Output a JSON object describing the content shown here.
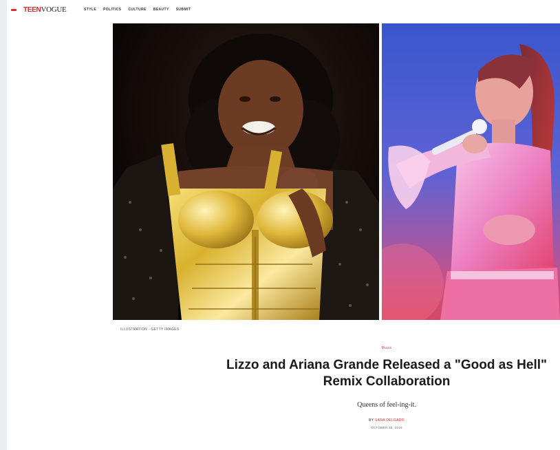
{
  "header": {
    "logo_teen": "TEEN",
    "logo_vogue": "VOGUE",
    "nav": [
      "STYLE",
      "POLITICS",
      "CULTURE",
      "BEAUTY",
      "SUBMIT"
    ]
  },
  "hero": {
    "caption": "ILLUSTRATION · GETTY IMAGES"
  },
  "article": {
    "section": "Music",
    "headline_line1": "Lizzo and Ariana Grande Released a \"Good as Hell\"",
    "headline_line2": "Remix Collaboration",
    "dek": "Queens of feel-ing-it.",
    "byline_prefix": "BY",
    "author": "SARA DELGADO",
    "date": "OCTOBER 25, 2019"
  },
  "colors": {
    "accent": "#e0242a",
    "left_photo_bg": "#0b0706",
    "right_photo_bg": "#4a5bd3"
  }
}
